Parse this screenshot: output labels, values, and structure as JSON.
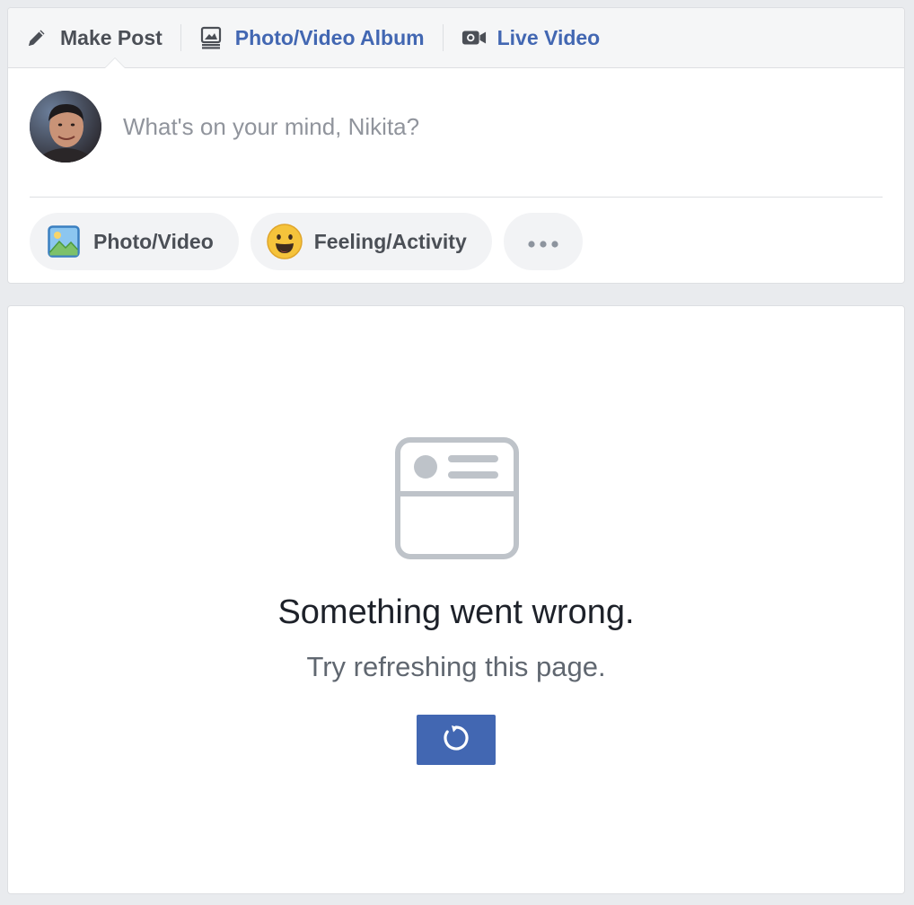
{
  "composer": {
    "tabs": [
      {
        "label": "Make Post",
        "icon": "pencil-icon"
      },
      {
        "label": "Photo/Video Album",
        "icon": "photo-album-icon"
      },
      {
        "label": "Live Video",
        "icon": "video-camera-icon"
      }
    ],
    "placeholder": "What's on your mind, Nikita?",
    "actions": [
      {
        "label": "Photo/Video",
        "icon": "photo-icon"
      },
      {
        "label": "Feeling/Activity",
        "icon": "smiley-face-icon"
      },
      {
        "label": "",
        "icon": "more-icon"
      }
    ]
  },
  "error": {
    "title": "Something went wrong.",
    "subtitle": "Try refreshing this page.",
    "icon": "feed-story-icon",
    "refresh_icon": "refresh-icon"
  },
  "colors": {
    "accent": "#4267b2",
    "link": "#4267b2",
    "text": "#4b4f56",
    "muted": "#90949c",
    "background": "#e9ebee"
  }
}
